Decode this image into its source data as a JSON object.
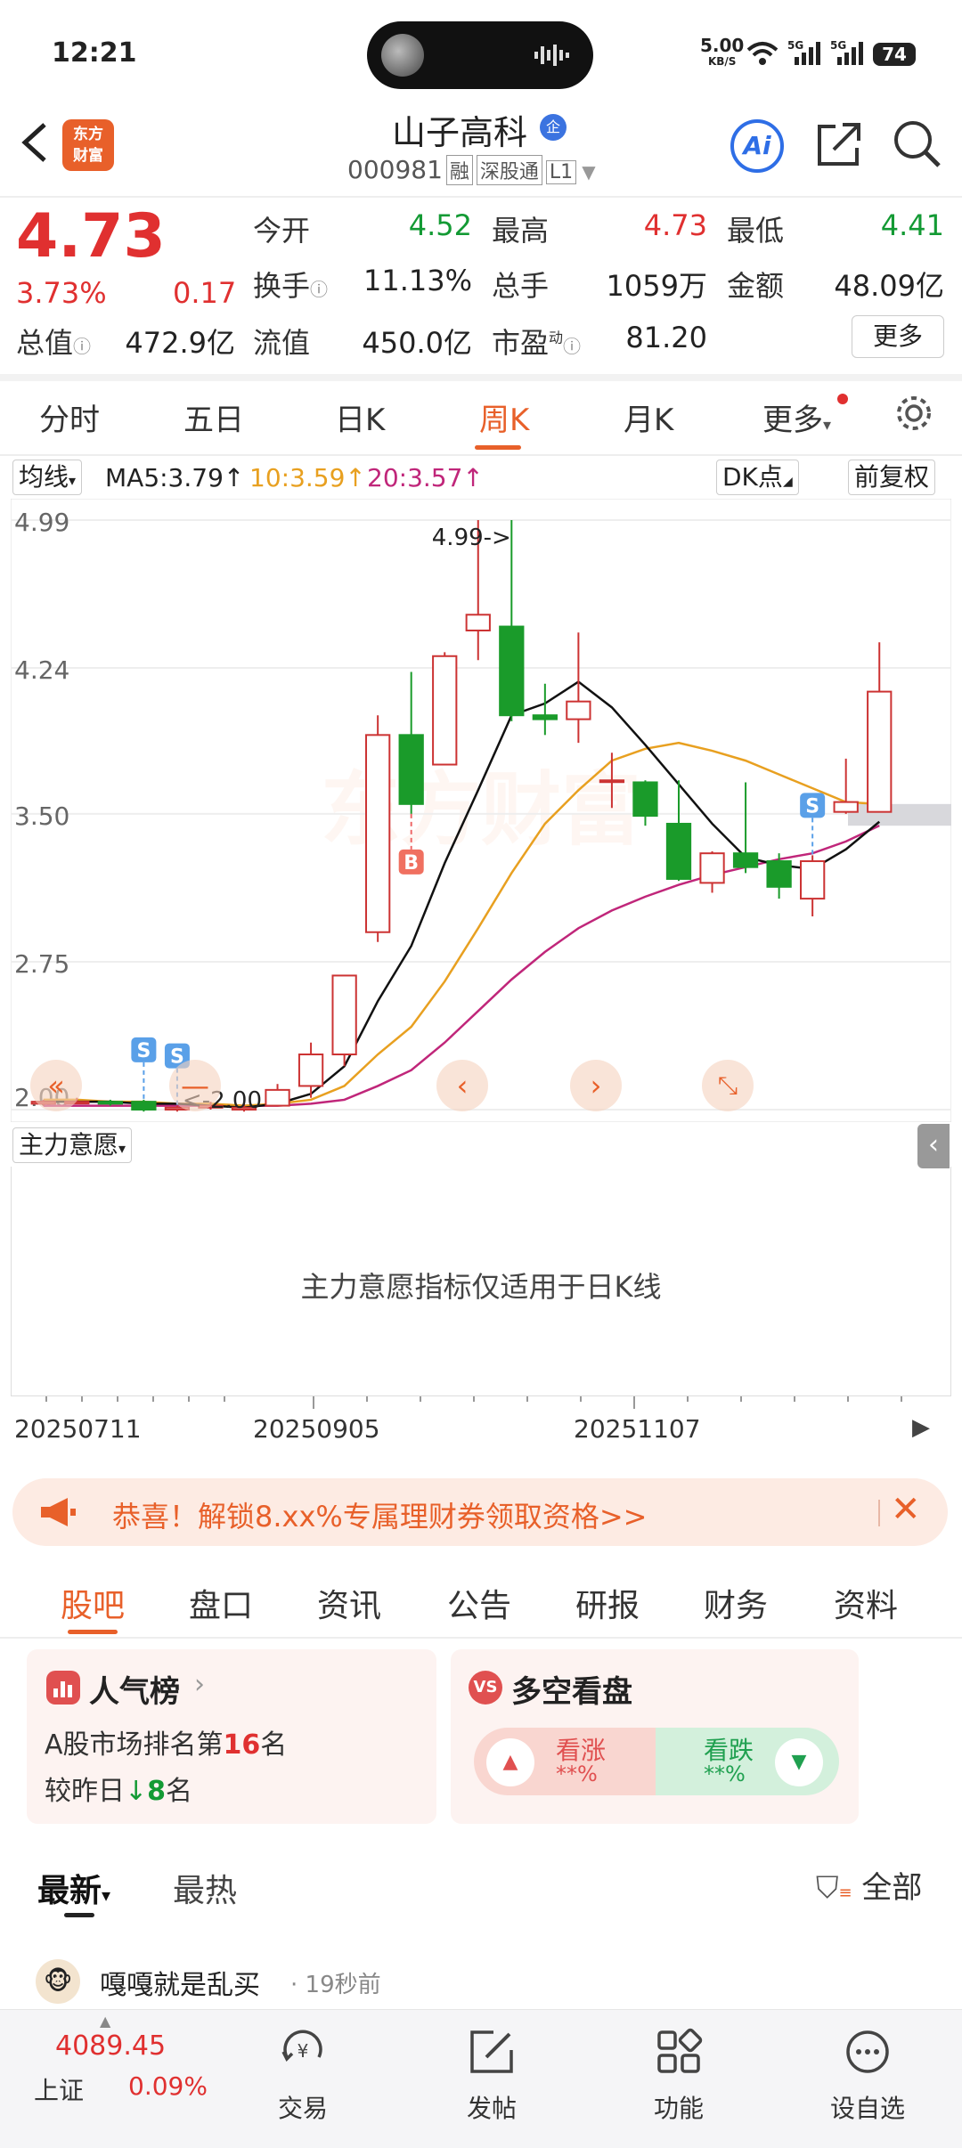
{
  "status_bar": {
    "time": "12:21",
    "net_speed": "5.00",
    "net_unit": "KB/S",
    "signal": "5G",
    "battery": "74"
  },
  "header": {
    "back_icon": "chevron-left-icon",
    "brand_logo": "东方财富",
    "title": "山子高科",
    "title_badge": "企",
    "code": "000981",
    "tags": [
      "融",
      "深股通",
      "L1"
    ],
    "ai_label": "Ai"
  },
  "quote": {
    "price": "4.73",
    "change_pct": "3.73%",
    "change": "0.17",
    "rows": [
      [
        {
          "label": "今开",
          "value": "4.52",
          "color": "green"
        },
        {
          "label": "最高",
          "value": "4.73",
          "color": "red"
        },
        {
          "label": "最低",
          "value": "4.41",
          "color": "green"
        }
      ],
      [
        {
          "label": "换手",
          "value": "11.13%",
          "color": "dark"
        },
        {
          "label": "总手",
          "value": "1059万",
          "color": "dark"
        },
        {
          "label": "金额",
          "value": "48.09亿",
          "color": "dark"
        }
      ],
      [
        {
          "label": "总值",
          "value": "472.9亿",
          "color": "dark"
        },
        {
          "label": "流值",
          "value": "450.0亿",
          "color": "dark"
        },
        {
          "label": "市盈",
          "label_sup": "动",
          "value": "81.20",
          "color": "dark"
        }
      ]
    ],
    "more_label": "更多"
  },
  "chart_tabs": [
    "分时",
    "五日",
    "日K",
    "周K",
    "月K",
    "更多"
  ],
  "active_chart_tab": "周K",
  "chart_controls": {
    "indicator": "均线",
    "ma5": "MA5:3.79↑",
    "ma10": "10:3.59↑",
    "ma20": "20:3.57↑",
    "dk": "DK点",
    "adjust": "前复权"
  },
  "sub_indicator": {
    "name": "主力意愿",
    "message": "主力意愿指标仅适用于日K线"
  },
  "dates": [
    "20250711",
    "20250905",
    "20251107"
  ],
  "chart_data": {
    "type": "candlestick",
    "y_ticks": [
      "4.99",
      "4.24",
      "3.50",
      "2.75",
      "2.00"
    ],
    "ylim": [
      2.0,
      4.99
    ],
    "max_marker": "4.99->",
    "min_marker": "<-2.00",
    "colors": {
      "up": "#c33",
      "down": "#1a9b2a",
      "ma5": "#111111",
      "ma10": "#e8a020",
      "ma20": "#c0267a"
    },
    "candles": [
      {
        "o": 2.03,
        "c": 2.04,
        "h": 2.05,
        "l": 2.02
      },
      {
        "o": 2.04,
        "c": 2.04,
        "h": 2.06,
        "l": 2.03
      },
      {
        "o": 2.04,
        "c": 2.03,
        "h": 2.05,
        "l": 2.02
      },
      {
        "o": 2.04,
        "c": 2.0,
        "h": 2.05,
        "l": 1.99
      },
      {
        "o": 2.0,
        "c": 2.01,
        "h": 2.02,
        "l": 1.99
      },
      {
        "o": 2.01,
        "c": 2.02,
        "h": 2.04,
        "l": 2.0
      },
      {
        "o": 2.0,
        "c": 2.01,
        "h": 2.04,
        "l": 1.99
      },
      {
        "o": 2.02,
        "c": 2.1,
        "h": 2.13,
        "l": 2.02
      },
      {
        "o": 2.12,
        "c": 2.28,
        "h": 2.34,
        "l": 2.06
      },
      {
        "o": 2.28,
        "c": 2.68,
        "h": 2.68,
        "l": 2.22
      },
      {
        "o": 2.9,
        "c": 3.9,
        "h": 4.0,
        "l": 2.85
      },
      {
        "o": 3.9,
        "c": 3.55,
        "h": 4.22,
        "l": 3.5
      },
      {
        "o": 3.75,
        "c": 4.3,
        "h": 4.32,
        "l": 3.75
      },
      {
        "o": 4.43,
        "c": 4.51,
        "h": 4.99,
        "l": 4.28
      },
      {
        "o": 4.45,
        "c": 4.0,
        "h": 4.99,
        "l": 3.97
      },
      {
        "o": 4.0,
        "c": 3.98,
        "h": 4.16,
        "l": 3.9
      },
      {
        "o": 3.98,
        "c": 4.07,
        "h": 4.42,
        "l": 3.86
      },
      {
        "o": 3.67,
        "c": 3.67,
        "h": 3.81,
        "l": 3.53
      },
      {
        "o": 3.66,
        "c": 3.49,
        "h": 3.67,
        "l": 3.44
      },
      {
        "o": 3.45,
        "c": 3.17,
        "h": 3.67,
        "l": 3.16
      },
      {
        "o": 3.15,
        "c": 3.3,
        "h": 3.31,
        "l": 3.1
      },
      {
        "o": 3.3,
        "c": 3.23,
        "h": 3.66,
        "l": 3.2
      },
      {
        "o": 3.26,
        "c": 3.13,
        "h": 3.3,
        "l": 3.07
      },
      {
        "o": 3.07,
        "c": 3.26,
        "h": 3.29,
        "l": 2.98
      },
      {
        "o": 3.51,
        "c": 3.56,
        "h": 3.78,
        "l": 3.5
      },
      {
        "o": 3.51,
        "c": 4.12,
        "h": 4.37,
        "l": 3.51
      }
    ],
    "ma5": [
      2.04,
      2.04,
      2.04,
      2.03,
      2.03,
      2.02,
      2.01,
      2.03,
      2.08,
      2.22,
      2.55,
      2.83,
      3.25,
      3.62,
      4.0,
      4.06,
      4.17,
      4.04,
      3.85,
      3.65,
      3.45,
      3.28,
      3.24,
      3.22,
      3.32,
      3.46
    ],
    "ma10": [
      2.05,
      2.05,
      2.04,
      2.04,
      2.03,
      2.03,
      2.02,
      2.03,
      2.05,
      2.12,
      2.28,
      2.42,
      2.65,
      2.92,
      3.2,
      3.45,
      3.62,
      3.77,
      3.83,
      3.86,
      3.82,
      3.77,
      3.7,
      3.63,
      3.56,
      3.55
    ],
    "ma20": [
      2.02,
      2.02,
      2.02,
      2.02,
      2.02,
      2.02,
      2.02,
      2.02,
      2.03,
      2.05,
      2.12,
      2.2,
      2.34,
      2.5,
      2.66,
      2.8,
      2.92,
      3.01,
      3.08,
      3.14,
      3.19,
      3.23,
      3.27,
      3.3,
      3.36,
      3.44
    ],
    "signals": [
      {
        "index": 3,
        "label": "S"
      },
      {
        "index": 4,
        "label": "S"
      },
      {
        "index": 11,
        "label": "B"
      },
      {
        "index": 23,
        "label": "S"
      }
    ]
  },
  "banner": {
    "text": "恭喜！解锁8.xx%专属理财券领取资格>>"
  },
  "section_tabs": [
    "股吧",
    "盘口",
    "资讯",
    "公告",
    "研报",
    "财务",
    "资料"
  ],
  "active_section_tab": "股吧",
  "popularity": {
    "title": "人气榜",
    "rank_prefix": "A股市场排名第",
    "rank": "16",
    "rank_suffix": "名",
    "compare_prefix": "较昨日",
    "compare_value": "8",
    "compare_suffix": "名"
  },
  "bull_bear": {
    "title": "多空看盘",
    "vs_badge": "VS",
    "bull_label": "看涨",
    "bull_value": "**%",
    "bear_label": "看跌",
    "bear_value": "**%"
  },
  "feed": {
    "tabs": [
      "最新",
      "最热"
    ],
    "filter_label": "全部",
    "post_author": "嘎嘎就是乱买",
    "post_time": "· 19秒前"
  },
  "bottom_nav": {
    "index_value": "4089.45",
    "index_name": "上证",
    "index_pct": "0.09%",
    "items": [
      {
        "label": "交易",
        "icon": "yuan-cycle-icon"
      },
      {
        "label": "发帖",
        "icon": "edit-icon"
      },
      {
        "label": "功能",
        "icon": "grid-icon"
      },
      {
        "label": "设自选",
        "icon": "more-dots-icon"
      }
    ]
  }
}
